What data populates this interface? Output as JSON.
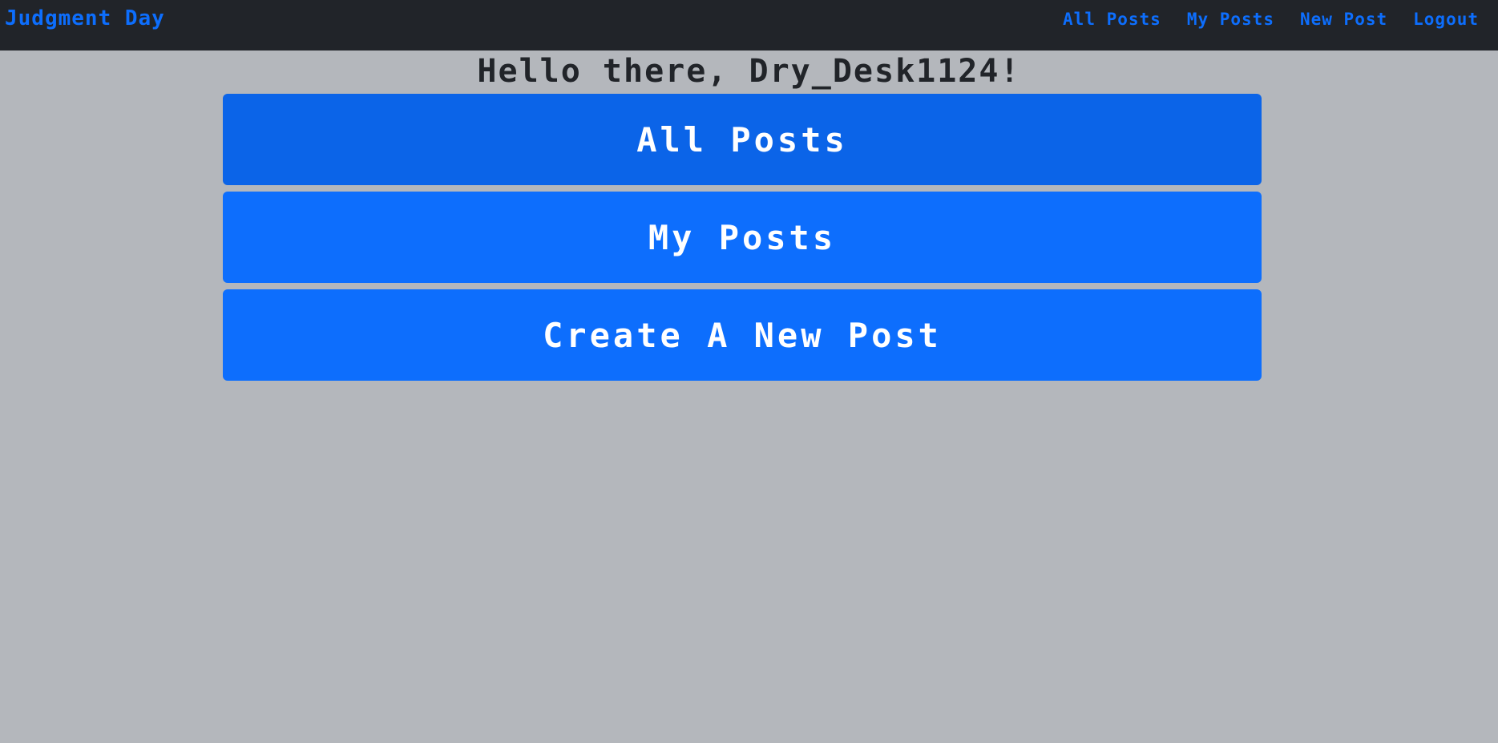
{
  "navbar": {
    "brand": "Judgment Day",
    "links": [
      {
        "label": "All Posts"
      },
      {
        "label": "My Posts"
      },
      {
        "label": "New Post"
      },
      {
        "label": "Logout"
      }
    ]
  },
  "main": {
    "greeting": "Hello there, Dry_Desk1124!",
    "buttons": [
      {
        "label": "All Posts",
        "state": "hover"
      },
      {
        "label": "My Posts"
      },
      {
        "label": "Create A New Post"
      }
    ]
  },
  "colors": {
    "navbar_bg": "#212429",
    "page_bg": "#b4b7bc",
    "accent": "#0d6efd",
    "accent_hover": "#0b64e8",
    "text_dark": "#212429"
  }
}
